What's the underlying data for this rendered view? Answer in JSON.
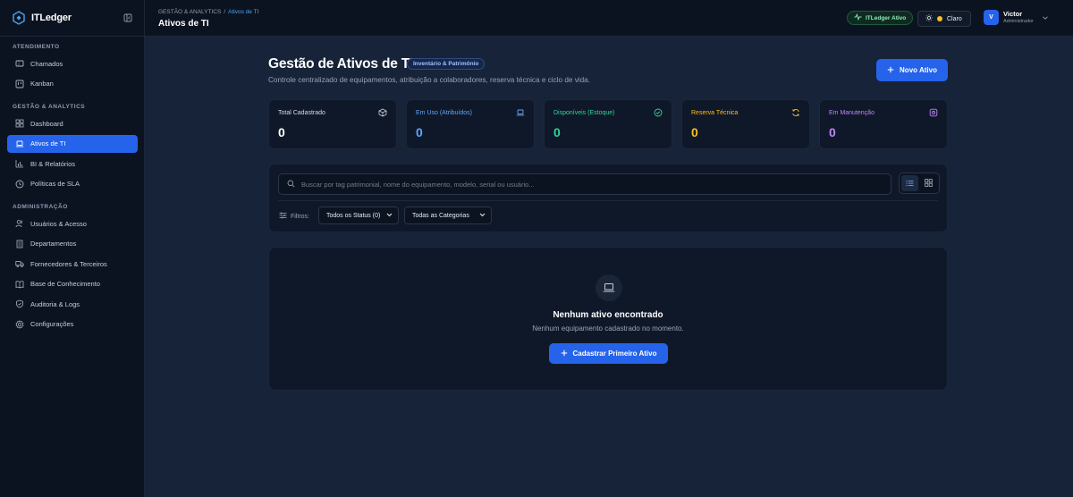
{
  "sidebar": {
    "brand": "ITLedger",
    "sections": [
      {
        "title": "ATENDIMENTO",
        "items": [
          "Chamados",
          "Kanban"
        ]
      },
      {
        "title": "GESTÃO & ANALYTICS",
        "items": [
          "Dashboard",
          "Ativos de TI",
          "BI & Relatórios",
          "Políticas de SLA"
        ]
      },
      {
        "title": "ADMINISTRAÇÃO",
        "items": [
          "Usuários & Acesso",
          "Departamentos",
          "Fornecedores & Terceiros",
          "Base de Conhecimento",
          "Auditoria & Logs",
          "Configurações"
        ]
      }
    ]
  },
  "header": {
    "breadcrumb_parent": "GESTÃO & ANALYTICS",
    "breadcrumb_sep": "/",
    "breadcrumb_current": "Ativos de TI",
    "title": "Ativos de TI",
    "status_label": "ITLedger Ativo",
    "theme_label": "Claro",
    "user_initial": "V",
    "user_name": "Victor",
    "user_role": "Administrador"
  },
  "main": {
    "title": "Gestão de Ativos de TI",
    "badge": "Inventário & Patrimônio",
    "subtitle": "Controle centralizado de equipamentos, atribuição a colaboradores, reserva técnica e ciclo de vida.",
    "new_button": "Novo Ativo",
    "stats": [
      {
        "label": "Total Cadastrado",
        "value": "0",
        "color": "#ffffff",
        "icon": "box-icon"
      },
      {
        "label": "Em Uso (Atribuídos)",
        "value": "0",
        "color": "#60a5fa",
        "icon": "laptop-icon"
      },
      {
        "label": "Disponíveis (Estoque)",
        "value": "0",
        "color": "#34d399",
        "icon": "check-circle-icon"
      },
      {
        "label": "Reserva Técnica",
        "value": "0",
        "color": "#fbbf24",
        "icon": "refresh-icon"
      },
      {
        "label": "Em Manutenção",
        "value": "0",
        "color": "#c084fc",
        "icon": "settings-icon"
      }
    ],
    "search_placeholder": "Buscar por tag patrimonial, nome do equipamento, modelo, serial ou usuário...",
    "filters_label": "Filtros:",
    "status_select": "Todos os Status (0)",
    "category_select": "Todas as Categorias",
    "empty_title": "Nenhum ativo encontrado",
    "empty_subtitle": "Nenhum equipamento cadastrado no momento.",
    "empty_button": "Cadastrar Primeiro Ativo"
  }
}
